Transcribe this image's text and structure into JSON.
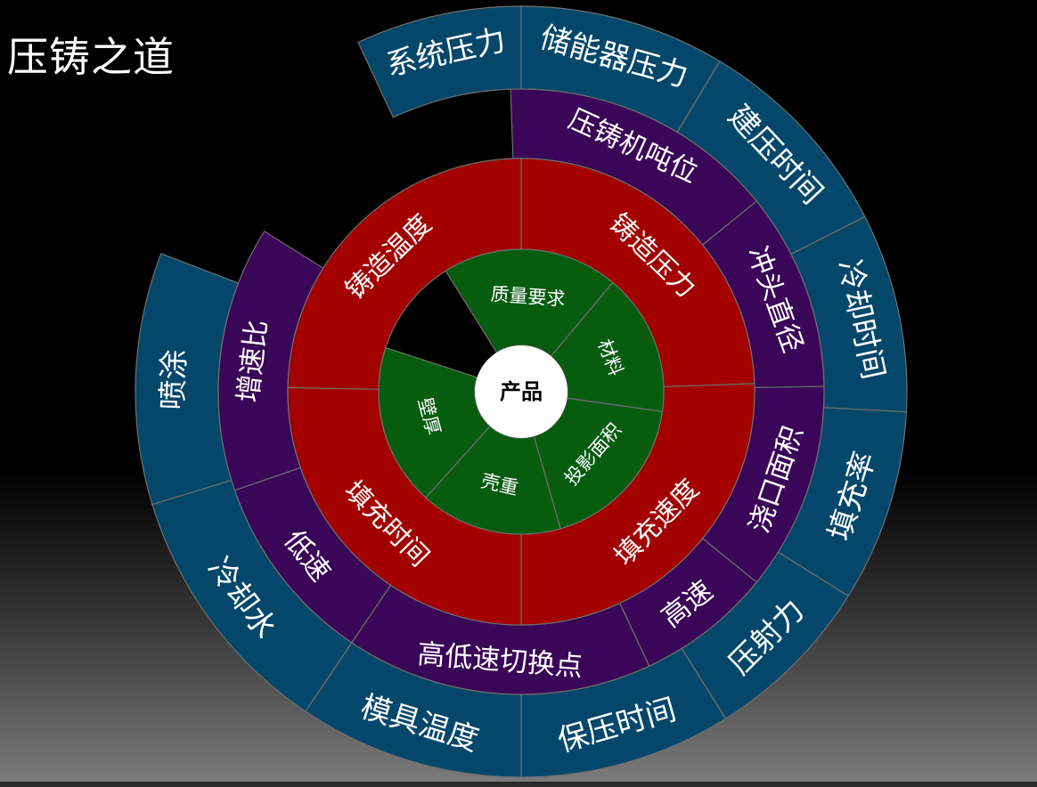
{
  "title": "压铸之道",
  "colors": {
    "outer": "#05476a",
    "purple": "#3a0657",
    "red": "#a30000",
    "green": "#075c10",
    "center": "#ffffff",
    "divider": "#6f6f6f"
  },
  "center": {
    "label": "产品"
  },
  "rings": [
    {
      "id": "green",
      "segments": [
        "质量要求",
        "材料",
        "投影面积",
        "壳重",
        "壁厚"
      ]
    },
    {
      "id": "red",
      "segments": [
        "铸造压力",
        "填充速度",
        "填充时间",
        "铸造温度"
      ]
    },
    {
      "id": "purple",
      "segments": [
        "压铸机吨位",
        "冲头直径",
        "浇口面积",
        "高速",
        "高低速切换点",
        "低速",
        "增速比"
      ]
    },
    {
      "id": "outer",
      "segments": [
        "系统压力",
        "储能器压力",
        "建压时间",
        "冷却时间",
        "填充率",
        "压射力",
        "保压时间",
        "模具温度",
        "冷却水",
        "喷涂"
      ]
    }
  ]
}
